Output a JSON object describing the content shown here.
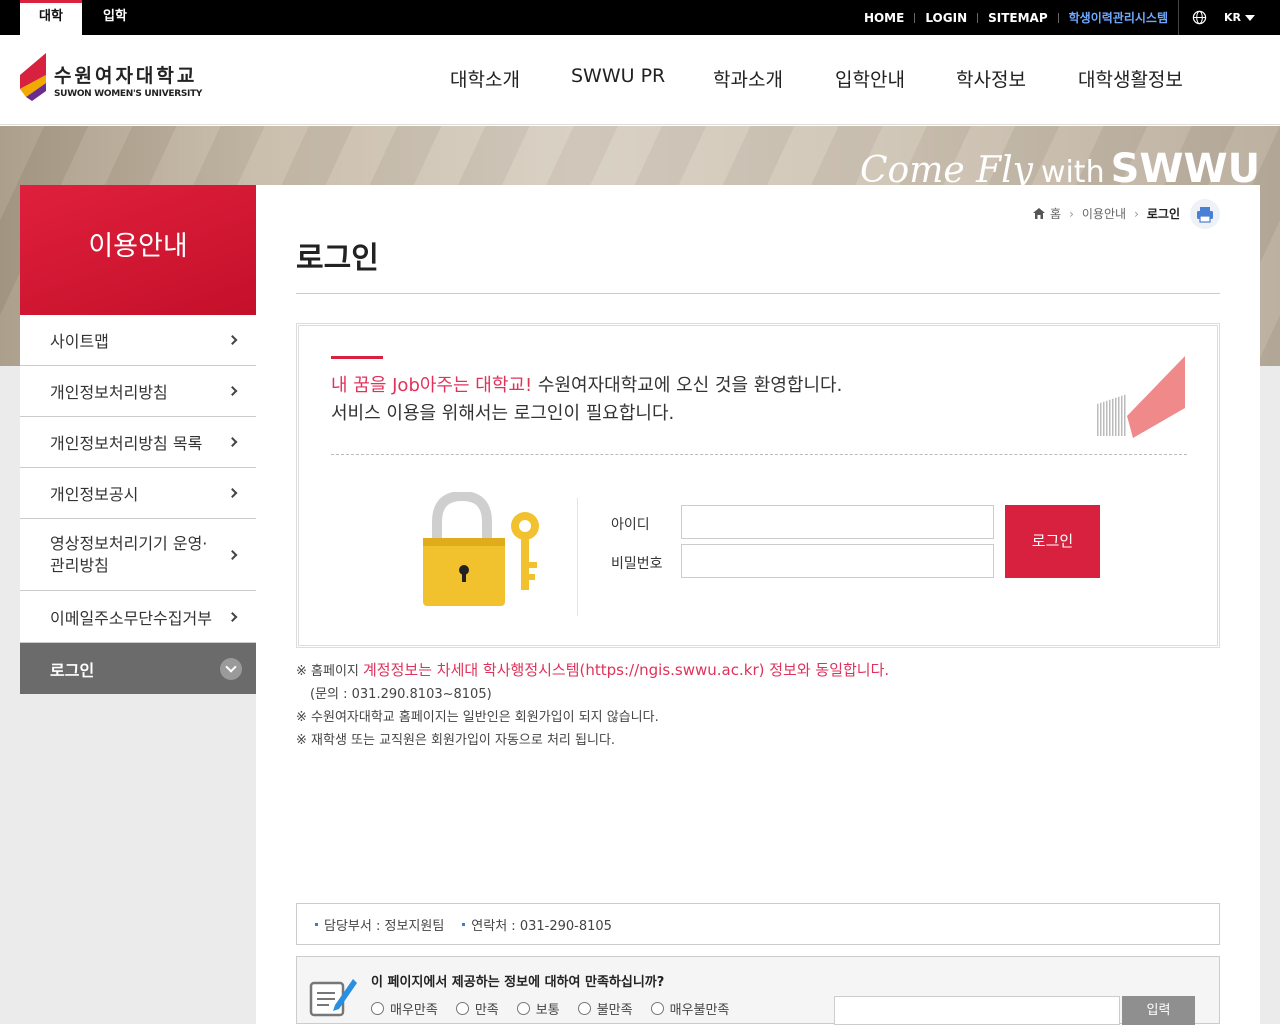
{
  "topbar": {
    "tabs": [
      {
        "label": "대학"
      },
      {
        "label": "입학"
      }
    ],
    "links": [
      {
        "label": "HOME"
      },
      {
        "label": "LOGIN"
      },
      {
        "label": "SITEMAP"
      },
      {
        "label": "학생이력관리시스템"
      }
    ],
    "lang": "KR"
  },
  "header": {
    "logo_name": "수원여자대학교",
    "logo_en": "SUWON WOMEN'S UNIVERSITY",
    "nav": [
      {
        "label": "대학소개"
      },
      {
        "label": "SWWU PR"
      },
      {
        "label": "학과소개"
      },
      {
        "label": "입학안내"
      },
      {
        "label": "학사정보"
      },
      {
        "label": "대학생활정보"
      }
    ]
  },
  "banner": {
    "script": "Come Fly",
    "with": "with",
    "brand": "SWWU"
  },
  "sidebar": {
    "title": "이용안내",
    "items": [
      {
        "label": "사이트맵"
      },
      {
        "label": "개인정보처리방침"
      },
      {
        "label": "개인정보처리방침 목록"
      },
      {
        "label": "개인정보공시"
      },
      {
        "label": "영상정보처리기기 운영·\n관리방침"
      },
      {
        "label": "이메일주소무단수집거부"
      },
      {
        "label": "로그인"
      }
    ]
  },
  "breadcrumb": {
    "home": "홈",
    "parent": "이용안내",
    "current": "로그인"
  },
  "page_title": "로그인",
  "login": {
    "welcome_pink": "내 꿈을 Job아주는 대학교!",
    "welcome_rest": " 수원여자대학교에 오신 것을 환영합니다.",
    "welcome_line2": "서비스 이용을 위해서는 로그인이 필요합니다.",
    "id_label": "아이디",
    "pw_label": "비밀번호",
    "id_value": "",
    "pw_value": "",
    "button": "로그인"
  },
  "notes": {
    "line1_prefix": "※ 홈페이지 ",
    "line1_pink": "계정정보는 차세대 학사행정시스템(https://ngis.swwu.ac.kr) 정보와 동일합니다.",
    "line2": "(문의 : 031.290.8103~8105)",
    "line3": "※ 수원여자대학교 홈페이지는 일반인은 회원가입이 되지 않습니다.",
    "line4": "※ 재학생 또는 교직원은 회원가입이 자동으로 처리 됩니다."
  },
  "info": {
    "dept": "담당부서 : 정보지원팀",
    "contact": "연락처 : 031-290-8105"
  },
  "survey": {
    "question": "이 페이지에서 제공하는 정보에 대하여 만족하십니까?",
    "options": [
      {
        "label": "매우만족"
      },
      {
        "label": "만족"
      },
      {
        "label": "보통"
      },
      {
        "label": "불만족"
      },
      {
        "label": "매우불만족"
      }
    ],
    "input_value": "",
    "submit": "입력"
  },
  "colors": {
    "accent": "#d7213f",
    "pink_text": "#e0325b",
    "link_blue": "#6fa9ff"
  },
  "icons": [
    "globe-icon",
    "home-icon",
    "print-icon",
    "lock-icon",
    "key-icon",
    "survey-pen-icon",
    "chevron-right-icon"
  ]
}
